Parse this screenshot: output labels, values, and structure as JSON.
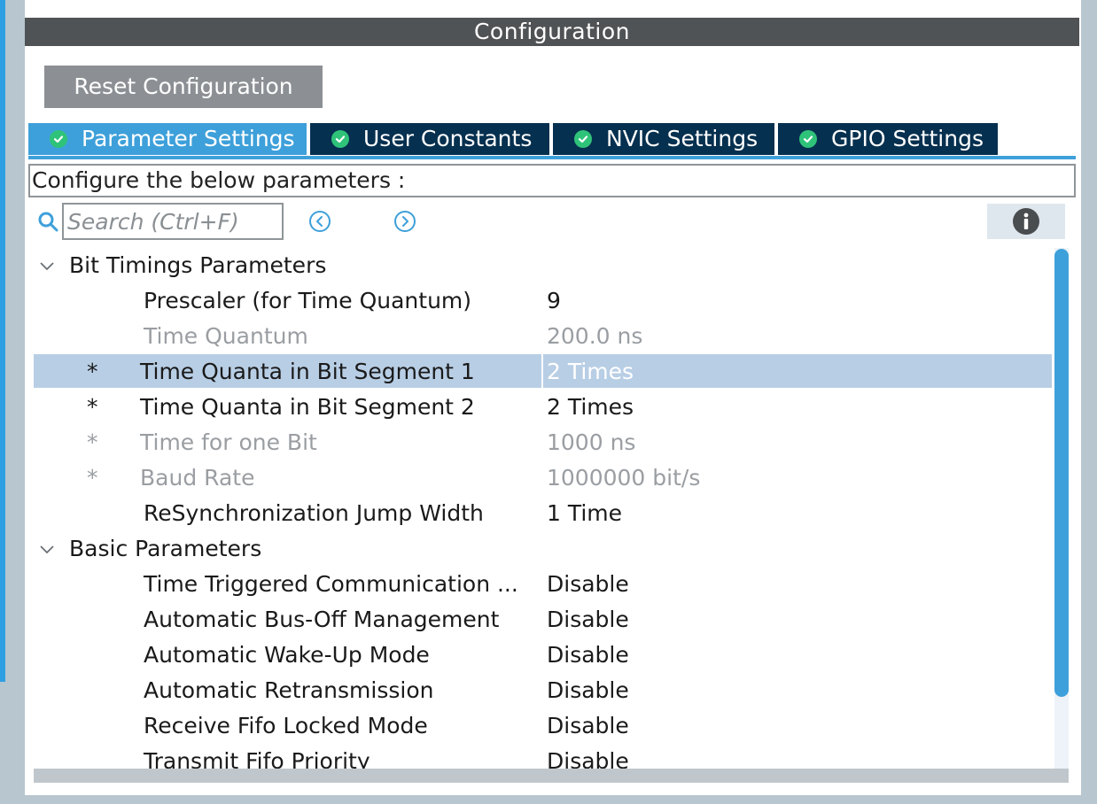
{
  "header": {
    "title": "Configuration"
  },
  "toolbar": {
    "reset_label": "Reset Configuration"
  },
  "tabs": [
    {
      "label": "Parameter Settings",
      "active": true
    },
    {
      "label": "User Constants",
      "active": false
    },
    {
      "label": "NVIC Settings",
      "active": false
    },
    {
      "label": "GPIO Settings",
      "active": false
    }
  ],
  "hint": "Configure the below parameters :",
  "search": {
    "placeholder": "Search (Ctrl+F)"
  },
  "icons": {
    "search": "search-icon",
    "prev": "arrow-left-circle-icon",
    "next": "arrow-right-circle-icon",
    "info": "info-icon",
    "tab_status": "check-circle-icon",
    "expand": "chevron-down-icon"
  },
  "colors": {
    "accent": "#3ea0da",
    "tab_bg": "#06304f",
    "header_bg": "#505355",
    "ok_green": "#2fc37a",
    "selected_row": "#b8cee5"
  },
  "groups": [
    {
      "label": "Bit Timings Parameters",
      "params": [
        {
          "star": "",
          "name": "Prescaler (for Time Quantum)",
          "value": "9",
          "muted": false,
          "selected": false
        },
        {
          "star": "",
          "name": "Time Quantum",
          "value": "200.0 ns",
          "muted": true,
          "selected": false
        },
        {
          "star": "*",
          "name": "Time Quanta in Bit Segment 1",
          "value": "2 Times",
          "muted": false,
          "selected": true
        },
        {
          "star": "*",
          "name": "Time Quanta in Bit Segment 2",
          "value": "2 Times",
          "muted": false,
          "selected": false
        },
        {
          "star": "*",
          "name": "Time for one Bit",
          "value": "1000 ns",
          "muted": true,
          "selected": false
        },
        {
          "star": "*",
          "name": "Baud Rate",
          "value": "1000000 bit/s",
          "muted": true,
          "selected": false
        },
        {
          "star": "",
          "name": "ReSynchronization Jump Width",
          "value": "1 Time",
          "muted": false,
          "selected": false
        }
      ]
    },
    {
      "label": "Basic Parameters",
      "params": [
        {
          "star": "",
          "name": "Time Triggered Communication ...",
          "value": "Disable",
          "muted": false,
          "selected": false
        },
        {
          "star": "",
          "name": "Automatic Bus-Off Management",
          "value": "Disable",
          "muted": false,
          "selected": false
        },
        {
          "star": "",
          "name": "Automatic Wake-Up Mode",
          "value": "Disable",
          "muted": false,
          "selected": false
        },
        {
          "star": "",
          "name": "Automatic Retransmission",
          "value": "Disable",
          "muted": false,
          "selected": false
        },
        {
          "star": "",
          "name": "Receive Fifo Locked Mode",
          "value": "Disable",
          "muted": false,
          "selected": false
        },
        {
          "star": "",
          "name": "Transmit Fifo Priority",
          "value": "Disable",
          "muted": false,
          "selected": false
        }
      ]
    }
  ]
}
